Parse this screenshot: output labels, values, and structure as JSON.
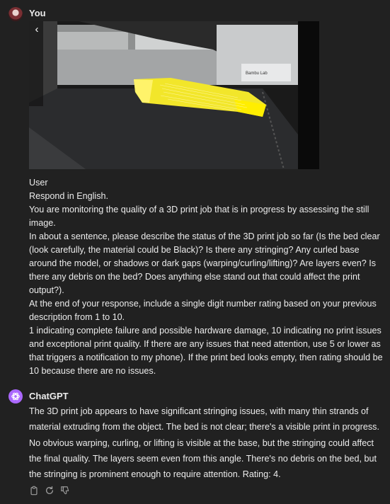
{
  "messages": {
    "user": {
      "author": "You",
      "label": "User",
      "paragraphs": [
        "Respond in English.",
        "You are monitoring the quality of a 3D print job that is in progress by assessing the still image.",
        "In about a sentence, please describe the status of the 3D print job so far (Is the bed clear (look carefully, the material could be Black)? Is there any stringing? Any curled base around the model, or shadows or dark gaps (warping/curling/lifting)? Are layers even? Is there any debris on the bed? Does anything else stand out that could affect the print output?).",
        "At the end of your response, include a single digit number rating based on your previous description from 1 to 10.",
        "1 indicating complete failure and possible hardware damage, 10 indicating no print issues and exceptional print quality. If there are any issues that need attention, use 5 or lower as that triggers a notification to my phone). If the print bed looks empty, then rating should be 10 because there are no issues."
      ],
      "image": {
        "printer_brand_text": "Bambu Lab",
        "back_glyph": "‹"
      }
    },
    "assistant": {
      "author": "ChatGPT",
      "text": "The 3D print job appears to have significant stringing issues, with many thin strands of material extruding from the object. The bed is not clear; there's a visible print in progress. No obvious warping, curling, or lifting is visible at the base, but the stringing could affect the final quality. The layers seem even from this angle. There's no debris on the bed, but the stringing is prominent enough to require attention. Rating: 4."
    }
  },
  "icons": {
    "user_avatar": "user-avatar",
    "assistant_avatar": "openai-logo-icon",
    "actions": [
      "copy-icon",
      "regenerate-icon",
      "thumbs-down-icon"
    ]
  },
  "colors": {
    "background": "#212121",
    "text": "#ececec",
    "assistant_avatar": "#ab68ff",
    "icon": "#9b9b9b",
    "filament": "#f2e62a"
  }
}
